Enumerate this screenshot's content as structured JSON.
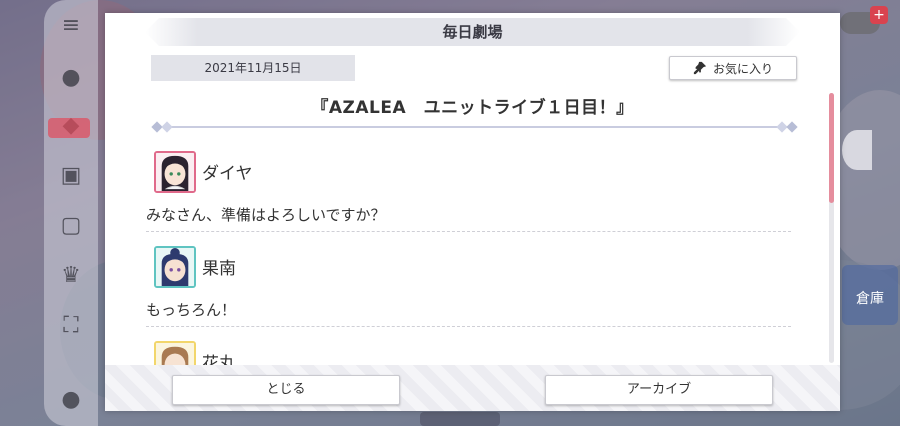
{
  "dialog": {
    "title": "毎日劇場",
    "date": "2021年11月15日",
    "favorite_label": "お気に入り",
    "story_title": "『AZALEA　ユニットライブ１日目！』",
    "messages": [
      {
        "speaker": "ダイヤ",
        "text": "みなさん、準備はよろしいですか？",
        "avatar_icon": "dia-avatar-icon"
      },
      {
        "speaker": "果南",
        "text": "もっちろん！",
        "avatar_icon": "kanan-avatar-icon"
      },
      {
        "speaker": "花丸",
        "text": "",
        "avatar_icon": "hanamaru-avatar-icon"
      }
    ],
    "close_label": "とじる",
    "archive_label": "アーカイブ"
  },
  "right_panel": {
    "plus_icon": "+",
    "shop_label": "倉庫"
  },
  "colors": {
    "accent_pink": "#e06a8b",
    "kanan_teal": "#5fc4c1",
    "hanamaru_yellow": "#f2d66b",
    "scroll_thumb": "#e58d9d"
  }
}
